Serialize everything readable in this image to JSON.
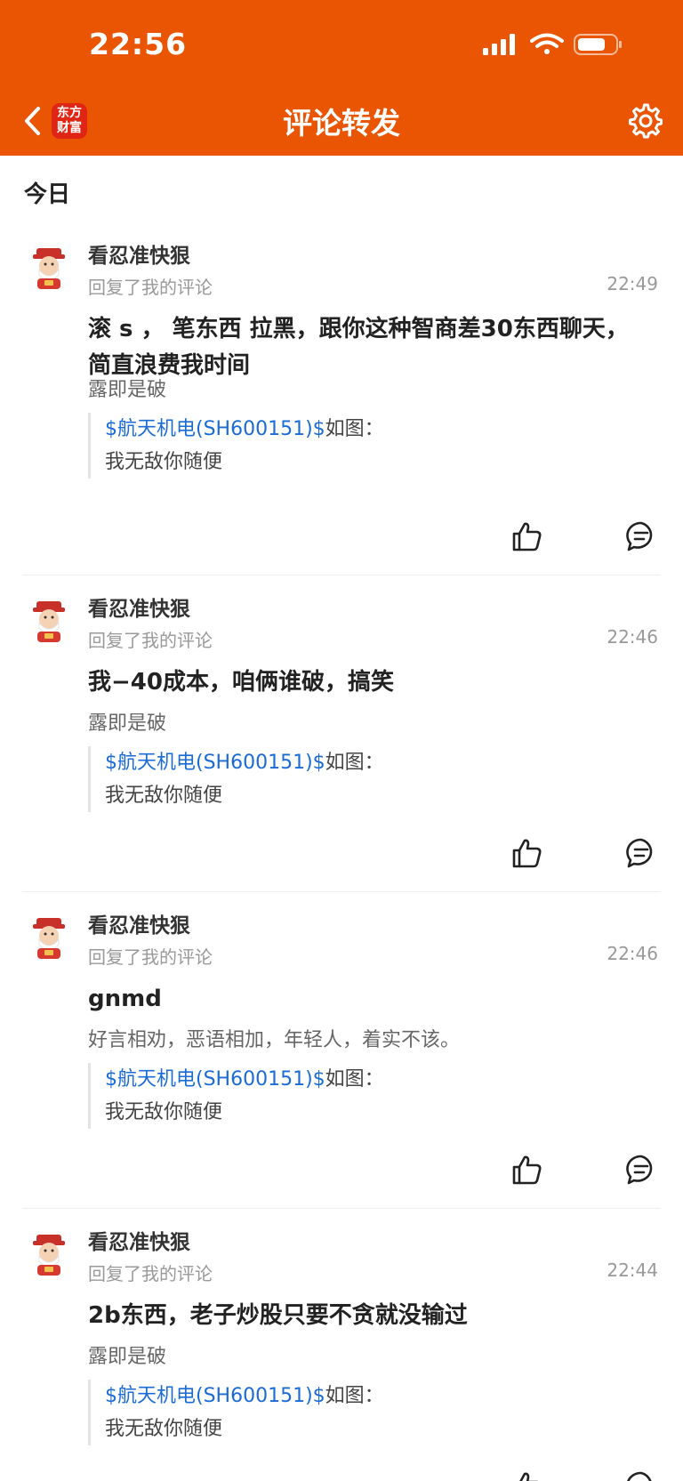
{
  "status_bar": {
    "time": "22:56",
    "icons": [
      "signal-icon",
      "wifi-icon",
      "battery-icon"
    ]
  },
  "nav": {
    "back_icon": "chevron-left-icon",
    "logo_line1": "东方",
    "logo_line2": "财富",
    "title": "评论转发",
    "settings_icon": "gear-icon"
  },
  "section_label": "今日",
  "colors": {
    "header_bg": "#ea5504",
    "link": "#1a6bd6"
  },
  "comments": [
    {
      "user": "看忍准快狠",
      "action": "回复了我的评论",
      "time": "22:49",
      "content": "滚 s ， 笔东西 拉黑，跟你这种智商差30东西聊天，简直浪费我时间",
      "original": "露即是破",
      "quote_link": "$航天机电(SH600151)$",
      "quote_suffix": "如图：",
      "quote_line2": "我无敌你随便"
    },
    {
      "user": "看忍准快狠",
      "action": "回复了我的评论",
      "time": "22:46",
      "content": "我−40成本，咱俩谁破，搞笑",
      "original": "露即是破",
      "quote_link": "$航天机电(SH600151)$",
      "quote_suffix": "如图：",
      "quote_line2": "我无敌你随便"
    },
    {
      "user": "看忍准快狠",
      "action": "回复了我的评论",
      "time": "22:46",
      "content": "gnmd",
      "original": "好言相劝，恶语相加，年轻人，着实不该。",
      "quote_link": "$航天机电(SH600151)$",
      "quote_suffix": "如图：",
      "quote_line2": "我无敌你随便"
    },
    {
      "user": "看忍准快狠",
      "action": "回复了我的评论",
      "time": "22:44",
      "content": "2b东西，老子炒股只要不贪就没输过",
      "original": "露即是破",
      "quote_link": "$航天机电(SH600151)$",
      "quote_suffix": "如图：",
      "quote_line2": "我无敌你随便"
    }
  ]
}
